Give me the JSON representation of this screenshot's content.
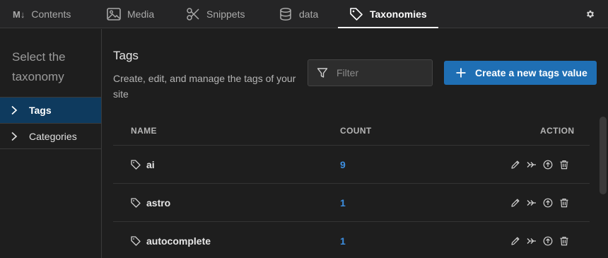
{
  "tabs": [
    {
      "label": "Contents",
      "icon": "markdown-icon",
      "active": false
    },
    {
      "label": "Media",
      "icon": "image-icon",
      "active": false
    },
    {
      "label": "Snippets",
      "icon": "scissors-icon",
      "active": false
    },
    {
      "label": "data",
      "icon": "database-icon",
      "active": false
    },
    {
      "label": "Taxonomies",
      "icon": "tag-icon",
      "active": true
    }
  ],
  "markdown_badge": "M↓",
  "sidebar": {
    "title": "Select the taxonomy",
    "items": [
      {
        "label": "Tags",
        "active": true
      },
      {
        "label": "Categories",
        "active": false
      }
    ]
  },
  "main": {
    "title": "Tags",
    "description": "Create, edit, and manage the tags of your site",
    "filter_placeholder": "Filter",
    "create_button": "Create a new tags value"
  },
  "table": {
    "headers": {
      "name": "NAME",
      "count": "COUNT",
      "action": "ACTION"
    },
    "rows": [
      {
        "name": "ai",
        "count": "9"
      },
      {
        "name": "astro",
        "count": "1"
      },
      {
        "name": "autocomplete",
        "count": "1"
      }
    ]
  },
  "colors": {
    "accent": "#1f6fb4",
    "active_side": "#0e3a5e",
    "count": "#3d8fe0",
    "background": "#1e1e1e"
  }
}
